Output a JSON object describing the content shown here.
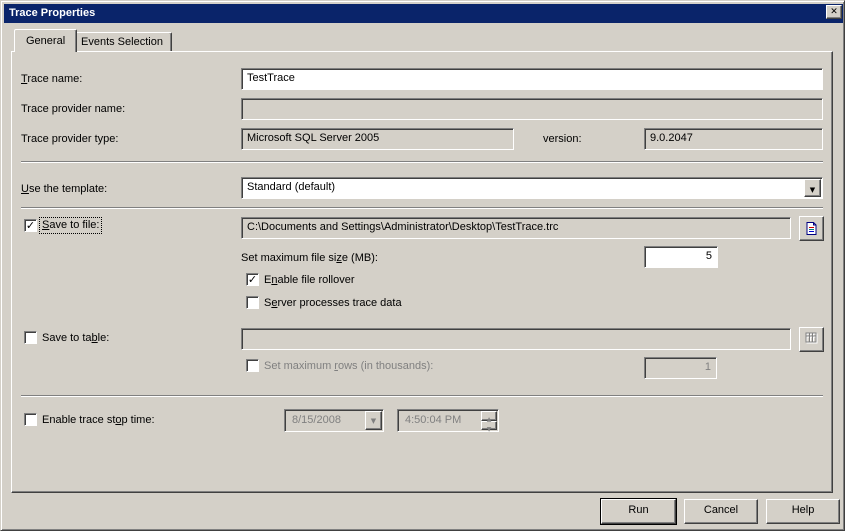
{
  "window": {
    "title": "Trace Properties"
  },
  "icons": {
    "close": "✕",
    "check": "✓",
    "dropdown": "▼",
    "spin_up": "▲",
    "spin_down": "▼"
  },
  "tabs": {
    "general": "General",
    "events": "Events Selection"
  },
  "general": {
    "trace_name": {
      "label_pre": "",
      "label_key": "T",
      "label_post": "race name:",
      "value": "TestTrace"
    },
    "provider_name": {
      "label": "Trace provider name:",
      "value": ""
    },
    "provider_type": {
      "label": "Trace provider type:",
      "value": "Microsoft SQL Server 2005"
    },
    "version": {
      "label": "version:",
      "value": "9.0.2047"
    },
    "template": {
      "label_pre": "",
      "label_key": "U",
      "label_post": "se the template:",
      "value": "Standard (default)"
    },
    "save_to_file": {
      "label_pre": "",
      "label_key": "S",
      "label_post": "ave to file:",
      "checked": true,
      "path": "C:\\Documents and Settings\\Administrator\\Desktop\\TestTrace.trc",
      "max_size": {
        "label_pre": "Set maximum file si",
        "label_key": "z",
        "label_post": "e (MB):",
        "value": "5"
      },
      "rollover": {
        "label_pre": "E",
        "label_key": "n",
        "label_post": "able file rollover",
        "checked": true
      },
      "server_processes": {
        "label_pre": "S",
        "label_key": "e",
        "label_post": "rver processes trace data",
        "checked": false
      }
    },
    "save_to_table": {
      "label_pre": "Save to ta",
      "label_key": "b",
      "label_post": "le:",
      "checked": false,
      "value": "",
      "max_rows": {
        "label_pre": "Set maximum ",
        "label_key": "r",
        "label_post": "ows (in thousands):",
        "value": "1",
        "checked": false
      }
    },
    "stop_time": {
      "label_pre": "Enable trace st",
      "label_key": "o",
      "label_post": "p time:",
      "checked": false,
      "date": "8/15/2008",
      "time": "4:50:04 PM"
    }
  },
  "buttons": {
    "run": "Run",
    "cancel": "Cancel",
    "help": "Help"
  }
}
